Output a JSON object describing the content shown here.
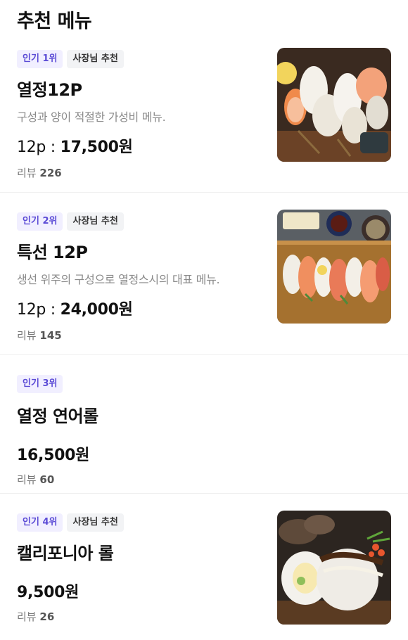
{
  "header": {
    "title": "추천 메뉴"
  },
  "items": [
    {
      "rank_badge": "인기 1위",
      "owner_badge": "사장님 추천",
      "name": "열정12P",
      "description": "구성과 양이 적절한 가성비 메뉴.",
      "price_qty": "12p : ",
      "price_amount": "17,500원",
      "review_label": "리뷰",
      "review_count": "226",
      "image": "nigiri-sushi-platter"
    },
    {
      "rank_badge": "인기 2위",
      "owner_badge": "사장님 추천",
      "name": "특선 12P",
      "description": "생선 위주의 구성으로 열정스시의 대표 메뉴.",
      "price_qty": "12p : ",
      "price_amount": "24,000원",
      "review_label": "리뷰",
      "review_count": "145",
      "image": "assorted-sushi-board"
    },
    {
      "rank_badge": "인기 3위",
      "name": "열정 연어롤",
      "price_amount": "16,500원",
      "review_label": "리뷰",
      "review_count": "60"
    },
    {
      "rank_badge": "인기 4위",
      "owner_badge": "사장님 추천",
      "name": "캘리포니아 롤",
      "price_amount": "9,500원",
      "review_label": "리뷰",
      "review_count": "26",
      "image": "california-roll"
    }
  ],
  "colors": {
    "rank_badge_bg": "#f1efff",
    "rank_badge_text": "#5b4bd6",
    "owner_badge_bg": "#f2f3f5",
    "description_text": "#8a8a8a"
  }
}
